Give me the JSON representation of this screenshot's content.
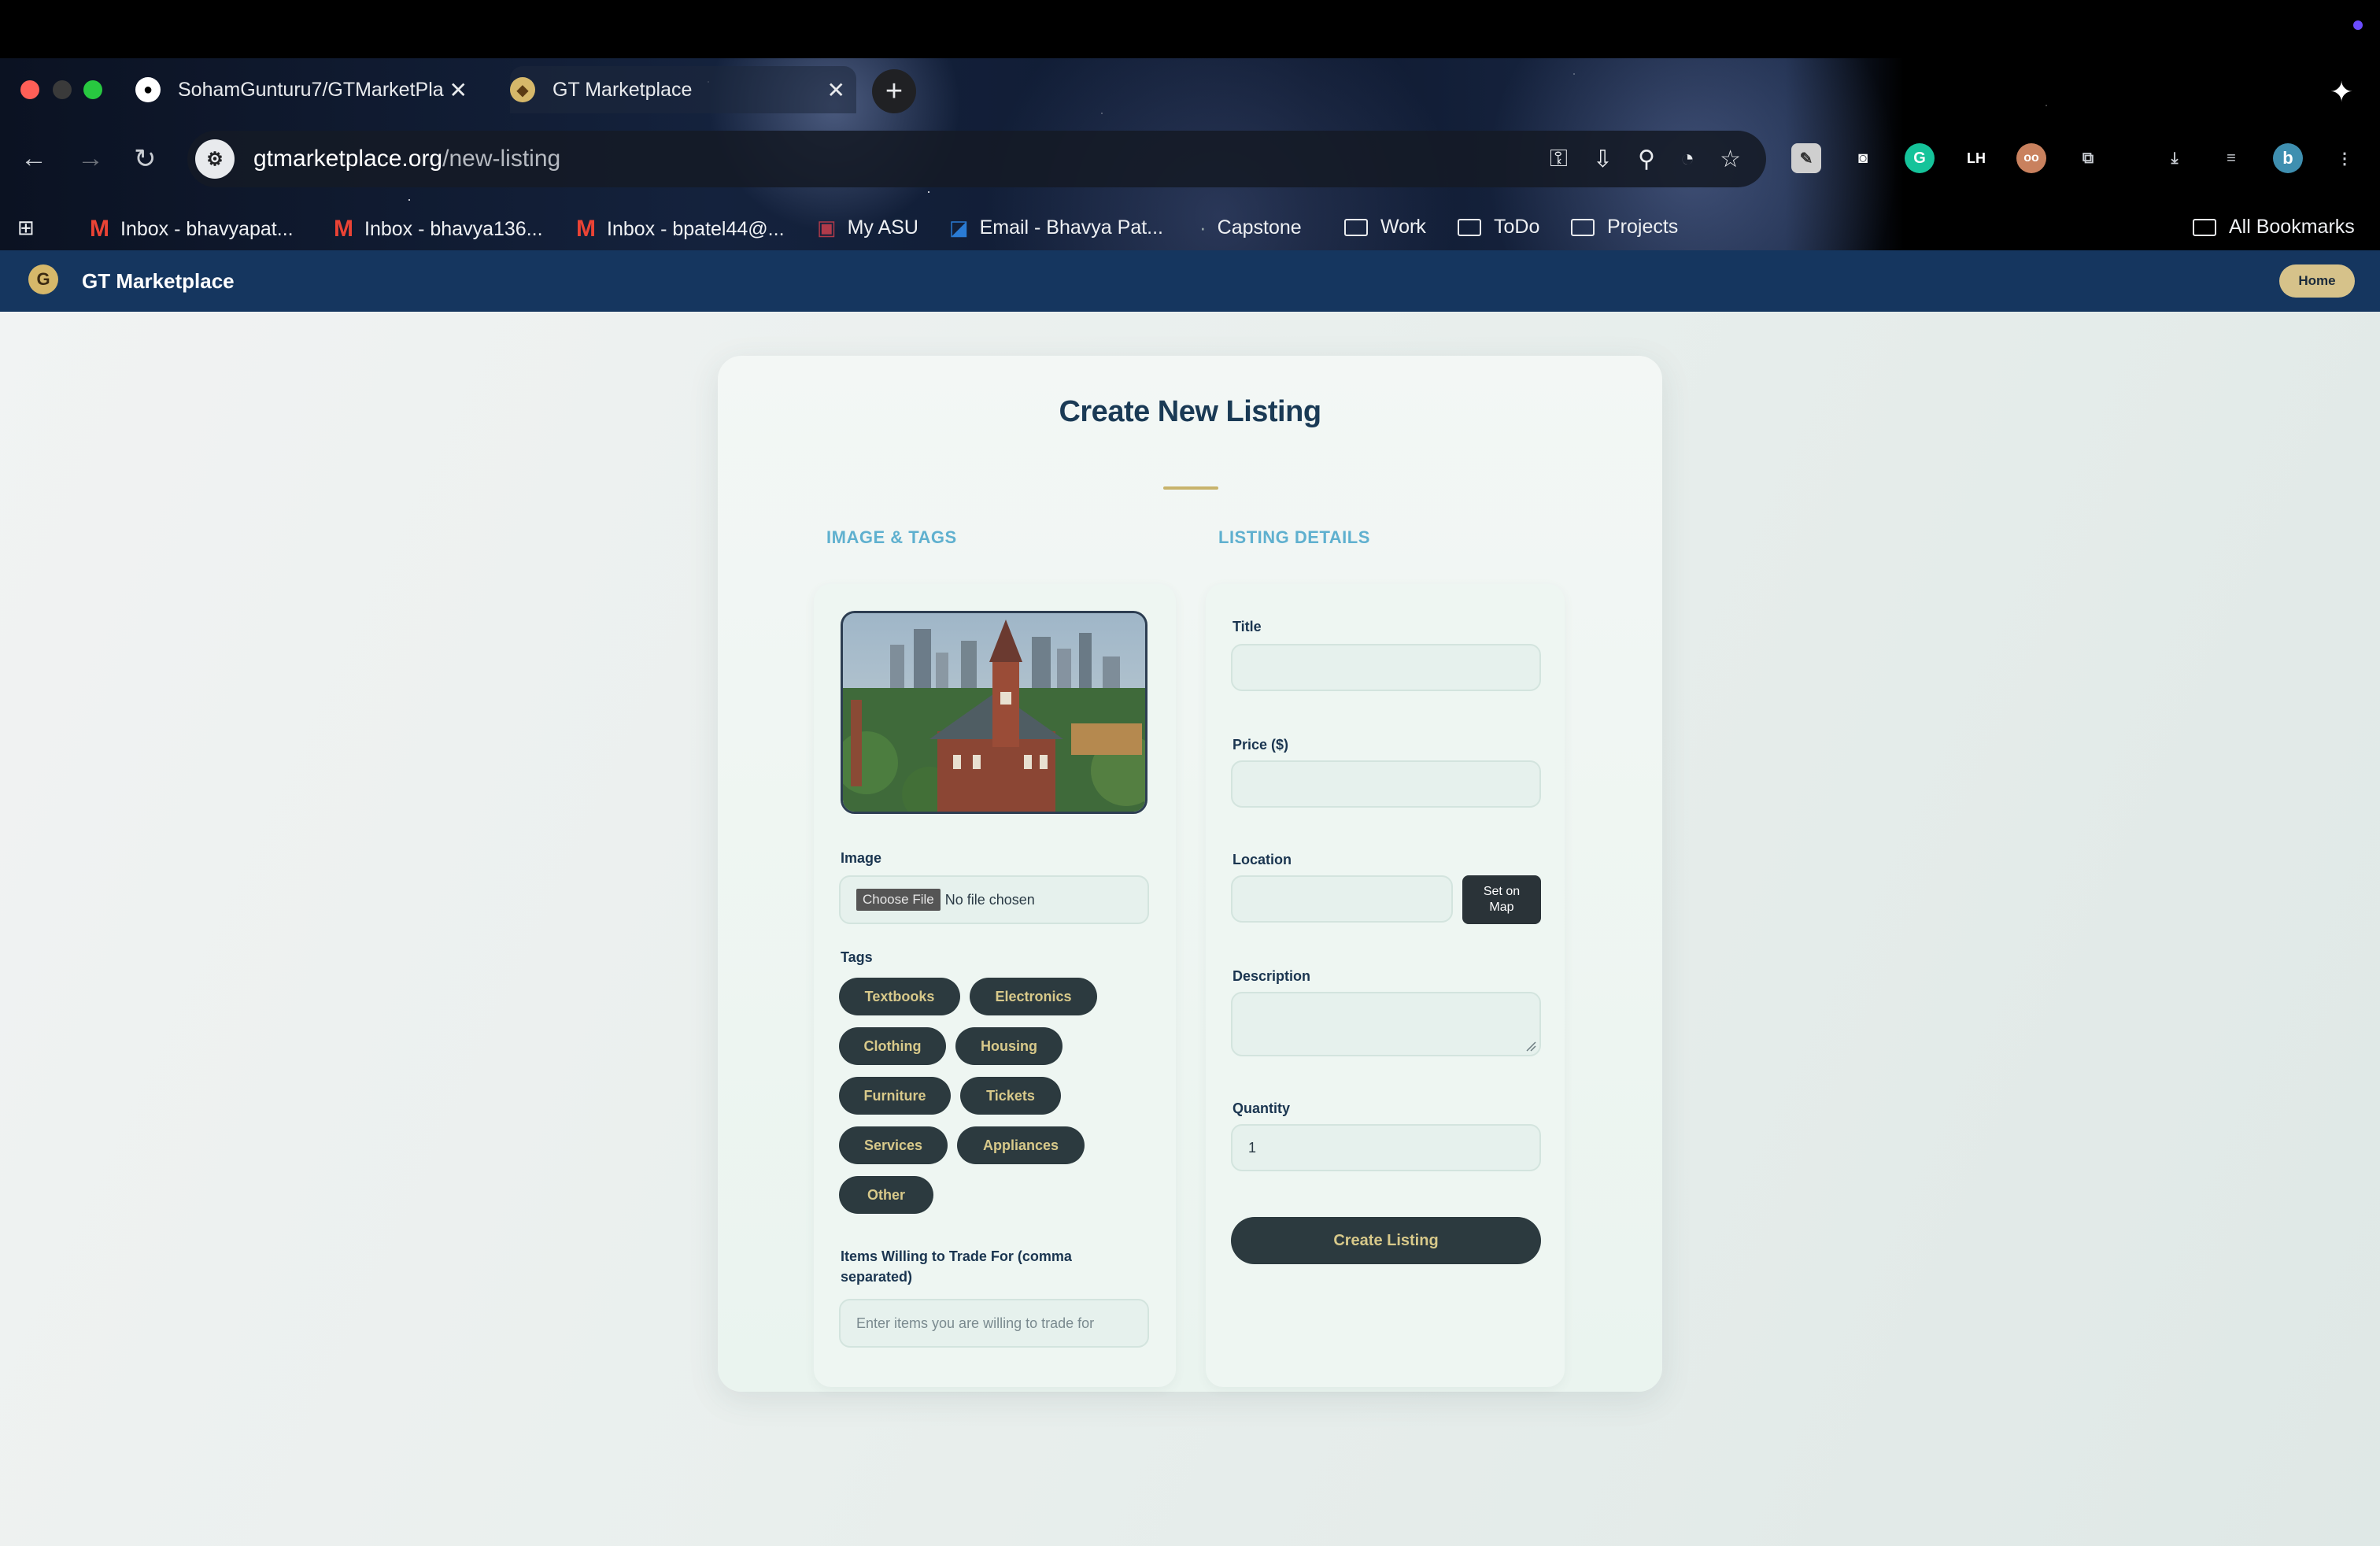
{
  "browser": {
    "tabs": [
      {
        "label": "SohamGunturu7/GTMarketPla",
        "active": false
      },
      {
        "label": "GT Marketplace",
        "active": true
      }
    ],
    "url_domain": "gtmarketplace.org",
    "url_path": "/new-listing",
    "bookmarks": [
      {
        "label": "Inbox - bhavyapat...",
        "icon": "gmail-icon"
      },
      {
        "label": "Inbox - bhavya136...",
        "icon": "gmail-icon"
      },
      {
        "label": "Inbox - bpatel44@...",
        "icon": "gmail-icon"
      },
      {
        "label": "My ASU",
        "icon": "asu-icon"
      },
      {
        "label": "Email - Bhavya Pat...",
        "icon": "outlook-icon"
      },
      {
        "label": "Capstone",
        "icon": "capstone-icon"
      },
      {
        "label": "Work",
        "icon": "folder-icon"
      },
      {
        "label": "ToDo",
        "icon": "folder-icon"
      },
      {
        "label": "Projects",
        "icon": "folder-icon"
      }
    ],
    "all_bookmarks_label": "All Bookmarks",
    "profile_initial": "b"
  },
  "appbar": {
    "brand": "GT Marketplace",
    "home_label": "Home"
  },
  "form": {
    "heading": "Create New Listing",
    "left_section_title": "IMAGE & TAGS",
    "right_section_title": "LISTING DETAILS",
    "image_label": "Image",
    "choose_file_label": "Choose File",
    "no_file_text": "No file chosen",
    "tags_label": "Tags",
    "tags": [
      "Textbooks",
      "Electronics",
      "Clothing",
      "Housing",
      "Furniture",
      "Tickets",
      "Services",
      "Appliances",
      "Other"
    ],
    "trade_label_line1": "Items Willing to Trade For (comma",
    "trade_label_line2": "separated)",
    "trade_placeholder": "Enter items you are willing to trade for",
    "title_label": "Title",
    "title_value": "",
    "price_label": "Price ($)",
    "price_value": "",
    "location_label": "Location",
    "location_value": "",
    "set_on_map_line1": "Set on",
    "set_on_map_line2": "Map",
    "description_label": "Description",
    "description_value": "",
    "quantity_label": "Quantity",
    "quantity_value": "1",
    "submit_label": "Create Listing"
  },
  "colors": {
    "appbar": "#15365f",
    "accent_gold": "#d6c28a",
    "tag_bg": "#2c3a3f",
    "section_title": "#5fb0cf"
  }
}
